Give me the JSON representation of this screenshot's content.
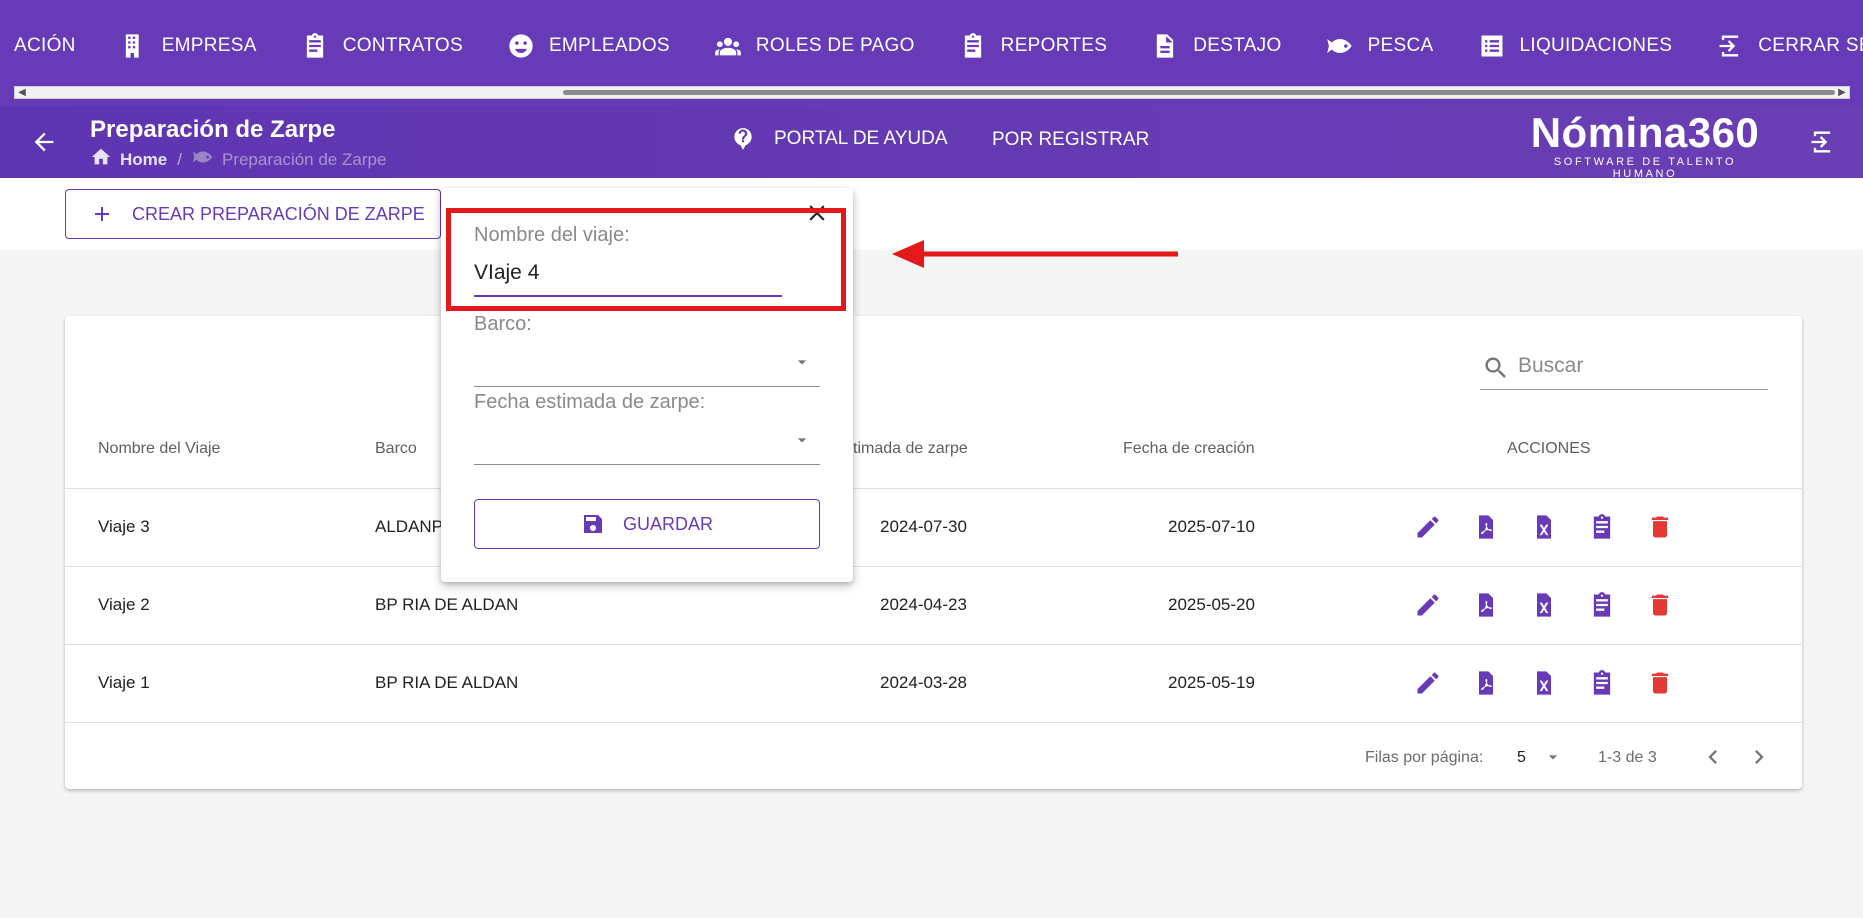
{
  "nav": {
    "items": [
      {
        "label": "ACIÓN",
        "icon": ""
      },
      {
        "label": "EMPRESA",
        "icon": "building-icon"
      },
      {
        "label": "CONTRATOS",
        "icon": "clipboard-icon"
      },
      {
        "label": "EMPLEADOS",
        "icon": "face-icon"
      },
      {
        "label": "ROLES DE PAGO",
        "icon": "people-icon"
      },
      {
        "label": "REPORTES",
        "icon": "clipboard-icon"
      },
      {
        "label": "DESTAJO",
        "icon": "document-icon"
      },
      {
        "label": "PESCA",
        "icon": "fish-icon"
      },
      {
        "label": "LIQUIDACIONES",
        "icon": "list-icon"
      },
      {
        "label": "CERRAR SESIÓN",
        "icon": "logout-icon"
      }
    ]
  },
  "header": {
    "title": "Preparación de Zarpe",
    "breadcrumb_home": "Home",
    "breadcrumb_current": "Preparación de Zarpe",
    "help_label": "PORTAL DE AYUDA",
    "register_label": "POR REGISTRAR",
    "logo_main": "Nómina360",
    "logo_sub": "SOFTWARE DE TALENTO HUMANO"
  },
  "toolbar": {
    "create_label": "CREAR PREPARACIÓN DE ZARPE"
  },
  "table": {
    "search_placeholder": "Buscar",
    "columns": [
      "Nombre del Viaje",
      "Barco",
      "Fecha estimada de zarpe",
      "Fecha de creación",
      "ACCIONES"
    ],
    "visible_columns": [
      "Nombre del Viaje",
      "Barco",
      "timada de zarpe",
      "Fecha de creación",
      "ACCIONES"
    ],
    "rows": [
      {
        "name": "Viaje 3",
        "boat": "ALDANP",
        "departure": "2024-07-30",
        "created": "2025-07-10"
      },
      {
        "name": "Viaje 2",
        "boat": "BP RIA DE ALDAN",
        "departure": "2024-04-23",
        "created": "2025-05-20"
      },
      {
        "name": "Viaje 1",
        "boat": "BP RIA DE ALDAN",
        "departure": "2024-03-28",
        "created": "2025-05-19"
      }
    ],
    "rows_per_page_label": "Filas por página:",
    "rows_per_page": "5",
    "range": "1-3 de 3"
  },
  "popup": {
    "name_label": "Nombre del viaje:",
    "name_value": "VIaje 4",
    "boat_label": "Barco:",
    "boat_value": "",
    "date_label": "Fecha estimada de zarpe:",
    "date_value": "",
    "save_label": "GUARDAR"
  },
  "colors": {
    "primary": "#673ab7",
    "delete": "#e53935",
    "annotation": "#e3191b"
  }
}
